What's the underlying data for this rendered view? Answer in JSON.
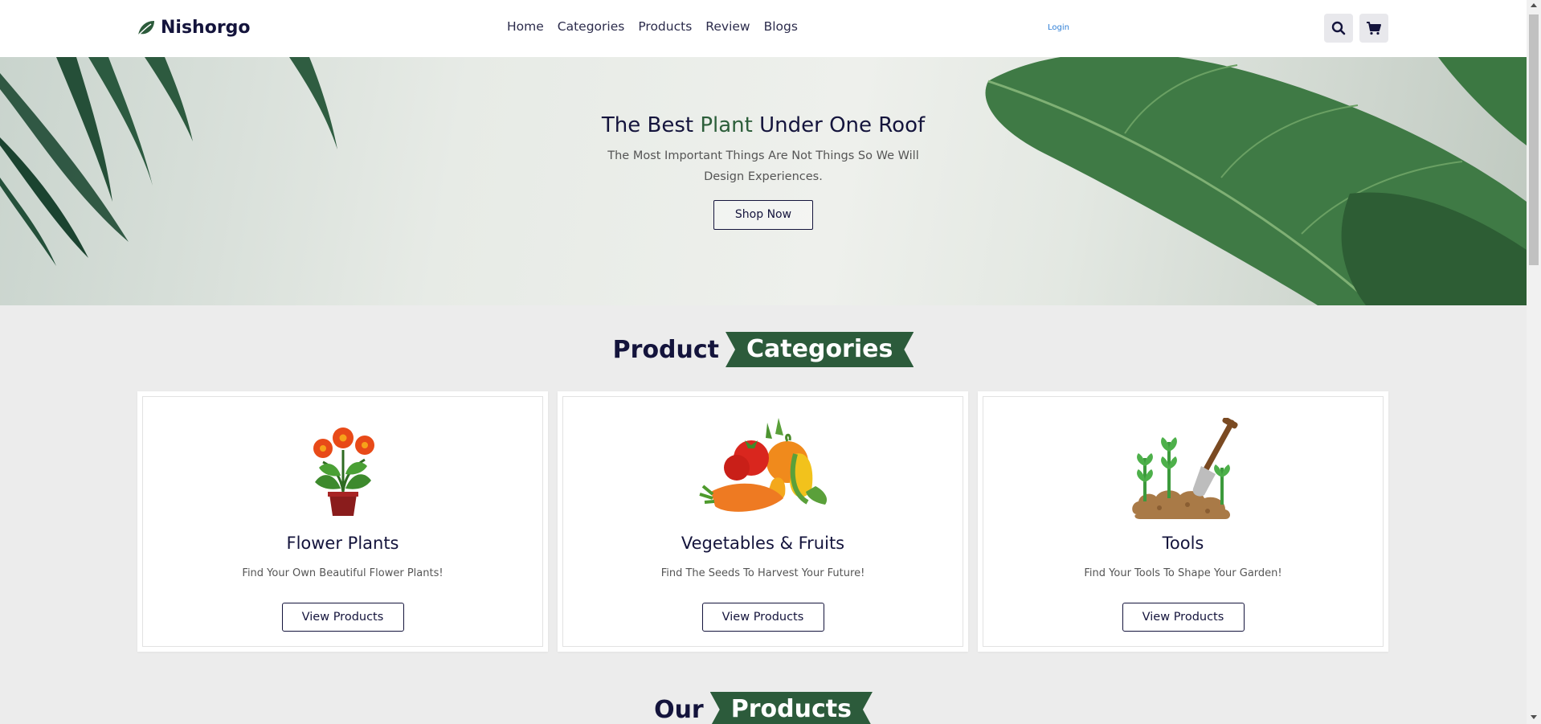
{
  "header": {
    "brand": "Nishorgo",
    "nav": [
      "Home",
      "Categories",
      "Products",
      "Review",
      "Blogs"
    ],
    "login": "Login",
    "icons": [
      "search-icon",
      "cart-icon"
    ]
  },
  "hero": {
    "title_before": "The Best ",
    "title_accent": "Plant",
    "title_after": " Under One Roof",
    "subtitle": "The Most Important Things Are Not Things So We Will Design Experiences.",
    "cta": "Shop Now"
  },
  "categories_section": {
    "title_plain": "Product",
    "title_ribbon": "Categories",
    "cards": [
      {
        "title": "Flower Plants",
        "desc": "Find Your Own Beautiful Flower Plants!",
        "button": "View Products",
        "icon": "flower-pot-icon"
      },
      {
        "title": "Vegetables & Fruits",
        "desc": "Find The Seeds To Harvest Your Future!",
        "button": "View Products",
        "icon": "vegetables-icon"
      },
      {
        "title": "Tools",
        "desc": "Find Your Tools To Shape Your Garden!",
        "button": "View Products",
        "icon": "shovel-plants-icon"
      }
    ]
  },
  "products_section": {
    "title_plain": "Our",
    "title_ribbon": "Products"
  },
  "colors": {
    "brand_dark": "#14143c",
    "accent_green": "#2c5b3b",
    "login_blue": "#2f7fd6"
  }
}
